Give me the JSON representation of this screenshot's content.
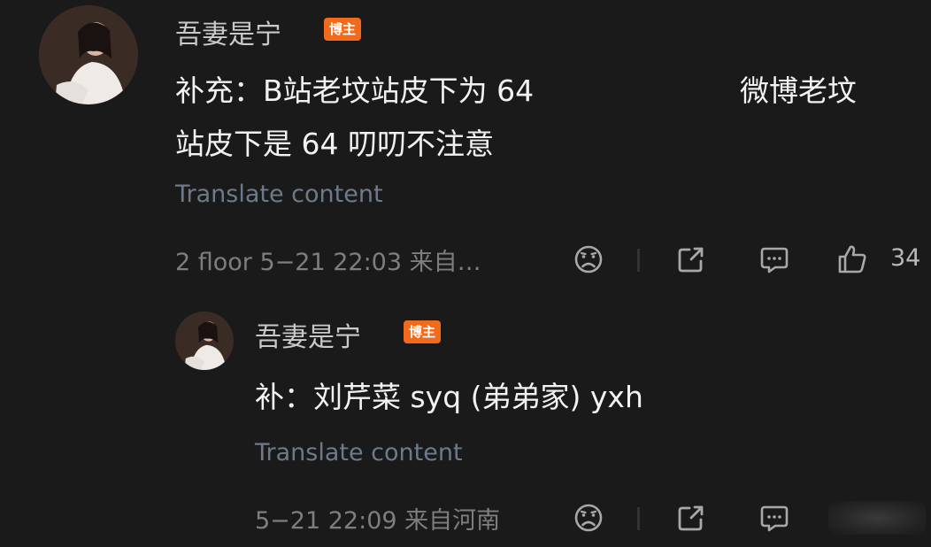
{
  "comment": {
    "username": "吾妻是宁",
    "badge": "博主",
    "text_line1a": "补充：B站老坟站皮下为 64",
    "text_line1b": "微博老坟",
    "text_line2": "站皮下是 64 叨叨不注意",
    "translate": "Translate content",
    "meta": "2 floor 5−21 22:03 来自…",
    "like_count": "34"
  },
  "reply": {
    "username": "吾妻是宁",
    "badge": "博主",
    "text": "补：刘芹菜  syq (弟弟家) yxh",
    "translate": "Translate content",
    "meta": "5−21 22:09 来自河南"
  },
  "colors": {
    "background": "#1a1a1a",
    "badge": "#f26a1b",
    "translate_link": "#6e7a8a"
  },
  "icons": [
    "avatar",
    "dislike-face-icon",
    "share-icon",
    "comment-icon",
    "thumbs-up-icon"
  ]
}
